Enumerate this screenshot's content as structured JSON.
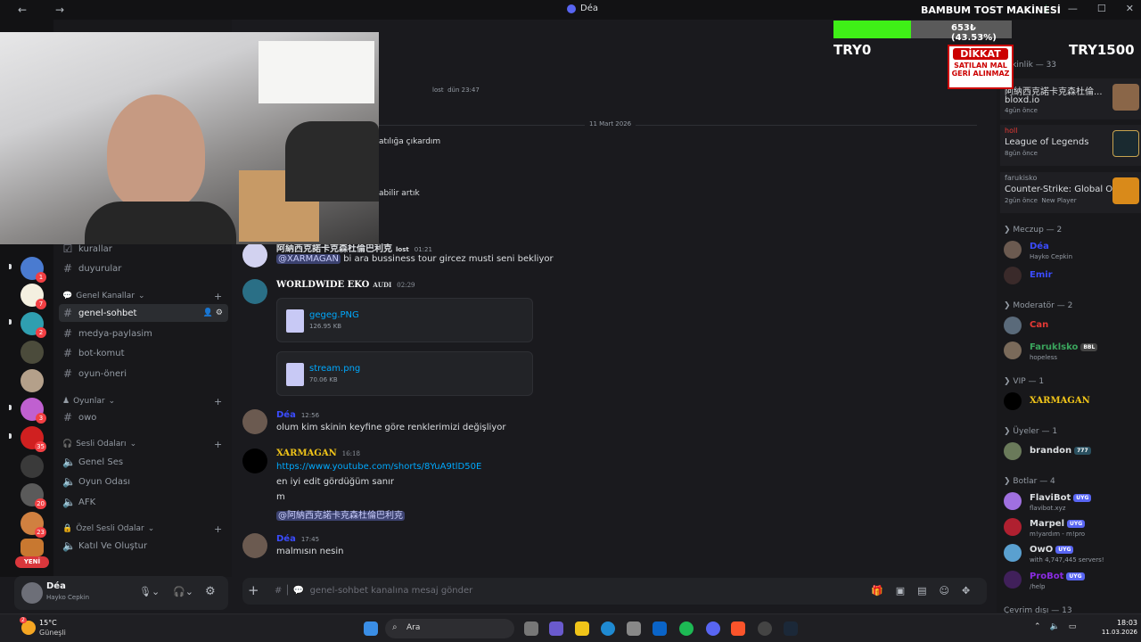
{
  "window": {
    "title": "Déa",
    "back": "←",
    "forward": "→"
  },
  "stream_overlay": {
    "goal_title": "BAMBUM TOST MAKİNESİ",
    "goal_progress_text": "653₺ (43.53%)",
    "goal_progress": 0.4353,
    "goal_min": "TRY0",
    "goal_max": "TRY1500",
    "warning_title": "DİKKAT",
    "warning_line1": "SATILAN MAL",
    "warning_line2": "GERİ ALINMAZ"
  },
  "channels": {
    "top_items": [
      {
        "label": "kurallar",
        "icon": "rules-icon"
      },
      {
        "label": "duyurular",
        "icon": "megaphone-icon"
      }
    ],
    "categories": [
      {
        "label": "Genel Kanallar",
        "items": [
          {
            "label": "genel-sohbet",
            "active": true
          },
          {
            "label": "medya-paylasim"
          },
          {
            "label": "bot-komut"
          },
          {
            "label": "oyun-öneri"
          }
        ]
      },
      {
        "label": "Oyunlar",
        "items": [
          {
            "label": "owo"
          }
        ]
      },
      {
        "label": "Sesli Odaları",
        "items": [
          {
            "label": "Genel Ses"
          },
          {
            "label": "Oyun Odası"
          },
          {
            "label": "AFK"
          }
        ]
      },
      {
        "label": "Özel Sesli Odalar",
        "items": [
          {
            "label": "Katıl Ve Oluştur"
          }
        ]
      }
    ]
  },
  "rail": {
    "new_label": "YENİ",
    "badges": [
      "1",
      "7",
      "2",
      "3",
      "35",
      "20",
      "23"
    ]
  },
  "user_panel": {
    "name": "Déa",
    "status": "Hayko Cepkin"
  },
  "chat": {
    "partial_time": "dün 23:47",
    "partial_role": "lost",
    "partial_text_1": "atılığa çıkardım",
    "partial_text_2": "abilir artık",
    "date_divider": "11 Mart 2026",
    "messages": [
      {
        "author": "阿納西克諾卡克森杜倫巴利克",
        "role": "lost",
        "time": "01:21",
        "mention": "@XARMAGAN",
        "text": "bi ara bussiness tour gircez musti seni bekliyor"
      },
      {
        "author": "WORLDWIDE EKO",
        "role": "AUDI",
        "time": "02:29",
        "files": [
          {
            "name": "gegeg.PNG",
            "size": "126.95 KB"
          },
          {
            "name": "stream.png",
            "size": "70.06 KB"
          }
        ]
      },
      {
        "author": "Déa",
        "time": "12:56",
        "text": "olum kim skinin keyfine göre renklerimizi değişliyor"
      },
      {
        "author": "XARMAGAN",
        "time": "16:18",
        "link": "https://www.youtube.com/shorts/8YuA9tlD50E",
        "text2": "en iyi edit gördüğüm sanır",
        "text3": "m",
        "mention2": "@阿納西克諾卡克森杜倫巴利克"
      },
      {
        "author": "Déa",
        "time": "17:45",
        "text": "malmısın nesin"
      }
    ],
    "composer_placeholder": "genel-sohbet kanalına mesaj gönder"
  },
  "members": {
    "activity_header": "Etkinlik — 33",
    "activities": [
      {
        "user": "",
        "game": "阿納西克諾卡克森杜倫...",
        "sub": "bloxd.io",
        "ago": "4gün önce",
        "art": "minecraft-avatar-icon"
      },
      {
        "user": "holl",
        "game": "League of Legends",
        "ago": "8gün önce",
        "art": "league-icon"
      },
      {
        "user": "farukisko",
        "game": "Counter-Strike: Global Off...",
        "ago": "2gün önce",
        "extra": "New Player",
        "art": "csgo-icon"
      }
    ],
    "groups": [
      {
        "label": "Meczup — 2",
        "members": [
          {
            "name": "Déa",
            "status": "Hayko Cepkin",
            "color": "#3b4cff"
          },
          {
            "name": "Emir",
            "status": "",
            "color": "#3b4cff"
          }
        ]
      },
      {
        "label": "Moderatör — 2",
        "members": [
          {
            "name": "Can",
            "status": "",
            "color": "#e53935"
          },
          {
            "name": "Faruklsko",
            "status": "hopeless",
            "badge": "BBL",
            "color": "#3aa55d"
          }
        ]
      },
      {
        "label": "VIP — 1",
        "members": [
          {
            "name": "XARMAGAN",
            "status": "",
            "color": "#f0c419"
          }
        ]
      },
      {
        "label": "Üyeler — 1",
        "members": [
          {
            "name": "brandon",
            "status": "",
            "badge": "777",
            "color": "#dbdee1"
          }
        ]
      },
      {
        "label": "Botlar — 4",
        "members": [
          {
            "name": "FlaviBot",
            "status": "flavibot.xyz",
            "badge": "UYG",
            "color": "#dbdee1"
          },
          {
            "name": "Marpel",
            "status": "m!yardım - m!pro",
            "badge": "UYG",
            "color": "#dbdee1"
          },
          {
            "name": "OwO",
            "status": "with 4,747,445 servers!",
            "badge": "UYG",
            "color": "#dbdee1"
          },
          {
            "name": "ProBot",
            "status": "/help",
            "badge": "UYG",
            "color": "#8a2be2"
          }
        ]
      }
    ],
    "offline_header": "Çevrim dışı — 13"
  },
  "taskbar": {
    "weather_temp": "15°C",
    "weather_desc": "Güneşli",
    "weather_badge": "2",
    "search_label": "Ara",
    "clock_time": "18:03",
    "clock_date": "11.03.2026"
  }
}
